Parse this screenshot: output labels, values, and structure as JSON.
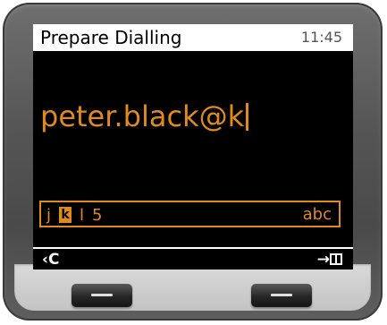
{
  "screen": {
    "title": "Prepare Dialling",
    "time": "11:45"
  },
  "entry": {
    "text": "peter.black@k"
  },
  "charset": {
    "chars_before": [
      "j"
    ],
    "selected_char": "k",
    "chars_after": [
      "l",
      "5"
    ],
    "input_mode": "abc"
  },
  "softkeys": {
    "left": "‹C",
    "right_arrow": "→",
    "right_icon": "phonebook-icon"
  },
  "hardware_keys": {
    "left_icon": "softkey-left-icon",
    "right_icon": "softkey-right-icon"
  },
  "colors": {
    "accent": "#e08a1e",
    "screen_bg": "#000000",
    "title_bg": "#ffffff"
  }
}
